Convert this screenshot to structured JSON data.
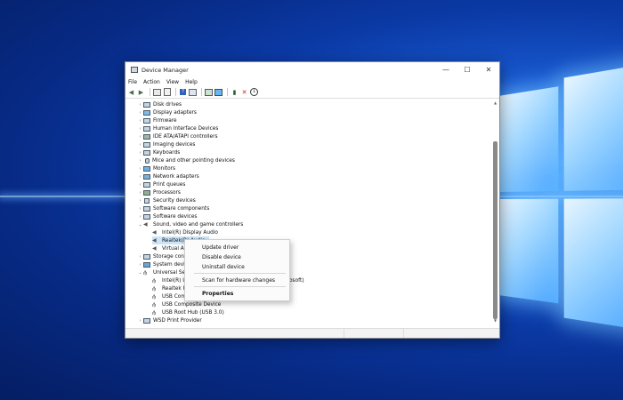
{
  "window": {
    "title": "Device Manager",
    "controls": {
      "minimize": "—",
      "maximize": "☐",
      "close": "✕"
    }
  },
  "menu": [
    "File",
    "Action",
    "View",
    "Help"
  ],
  "toolbar": {
    "icons": [
      "back-icon",
      "forward-icon",
      "show-hide-tree-icon",
      "properties-icon",
      "help-icon",
      "view-icon",
      "update-driver-icon",
      "monitor-icon",
      "disable-device-icon",
      "uninstall-icon",
      "download-icon"
    ]
  },
  "tree": {
    "categories": [
      "Disk drives",
      "Display adapters",
      "Firmware",
      "Human Interface Devices",
      "IDE ATA/ATAPI controllers",
      "Imaging devices",
      "Keyboards",
      "Mice and other pointing devices",
      "Monitors",
      "Network adapters",
      "Print queues",
      "Processors",
      "Security devices",
      "Software components",
      "Software devices",
      "Sound, video and game controllers"
    ],
    "sound_children": [
      "Intel(R) Display Audio",
      "Realtek(R) Audio",
      "Virtual Au"
    ],
    "more_categories": [
      "Storage contr",
      "System devi",
      "Universal Seri"
    ],
    "usb_children": [
      "Intel(R) US",
      "Realtek US",
      "USB Comp",
      "USB Composite Device",
      "USB Root Hub (USB 3.0)"
    ],
    "usb_child_suffix": "osoft)",
    "last_category": "WSD Print Provider"
  },
  "context_menu": {
    "update": "Update driver",
    "disable": "Disable device",
    "uninstall": "Uninstall device",
    "scan": "Scan for hardware changes",
    "properties": "Properties"
  }
}
